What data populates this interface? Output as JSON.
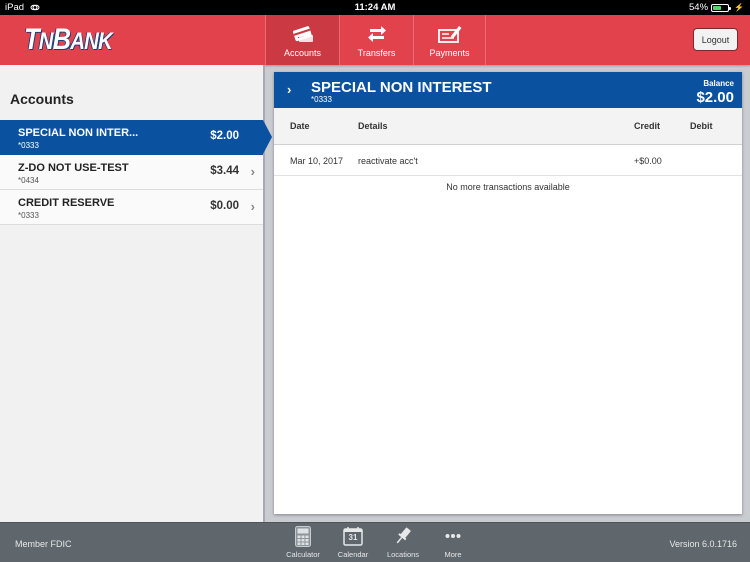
{
  "status_bar": {
    "device": "iPad",
    "time": "11:24 AM",
    "battery": "54%",
    "battery_level": 0.54
  },
  "header": {
    "logo_part1": "T",
    "logo_part2": "N",
    "logo_part3": "B",
    "logo_part4": "ANK",
    "tabs": [
      {
        "label": "Accounts",
        "icon": "credit-card-icon",
        "active": true
      },
      {
        "label": "Transfers",
        "icon": "transfer-arrows-icon",
        "active": false
      },
      {
        "label": "Payments",
        "icon": "check-pen-icon",
        "active": false
      }
    ],
    "logout_label": "Logout"
  },
  "sidebar": {
    "title": "Accounts",
    "accounts": [
      {
        "name": "SPECIAL NON INTER...",
        "number": "*0333",
        "amount": "$2.00",
        "selected": true
      },
      {
        "name": "Z-DO NOT USE-TEST",
        "number": "*0434",
        "amount": "$3.44",
        "selected": false
      },
      {
        "name": "CREDIT RESERVE",
        "number": "*0333",
        "amount": "$0.00",
        "selected": false
      }
    ]
  },
  "detail": {
    "account_name": "SPECIAL NON INTEREST",
    "account_number": "*0333",
    "balance_label": "Balance",
    "balance": "$2.00",
    "columns": [
      "Date",
      "Details",
      "Credit",
      "Debit"
    ],
    "transactions": [
      {
        "date": "Mar 10, 2017",
        "details": "reactivate acc't",
        "credit": "+$0.00",
        "debit": ""
      }
    ],
    "no_more_text": "No more transactions available"
  },
  "footer": {
    "member_fdic": "Member FDIC",
    "version": "Version 6.0.1716",
    "tools": [
      {
        "label": "Calculator",
        "icon": "calculator-icon"
      },
      {
        "label": "Calendar",
        "icon": "calendar-icon",
        "calendar_day": "31"
      },
      {
        "label": "Locations",
        "icon": "map-pin-icon"
      },
      {
        "label": "More",
        "icon": "more-dots-icon"
      }
    ]
  },
  "colors": {
    "brand_red": "#e2424b",
    "brand_blue": "#0a52a0",
    "footer_gray": "#5f666c"
  }
}
